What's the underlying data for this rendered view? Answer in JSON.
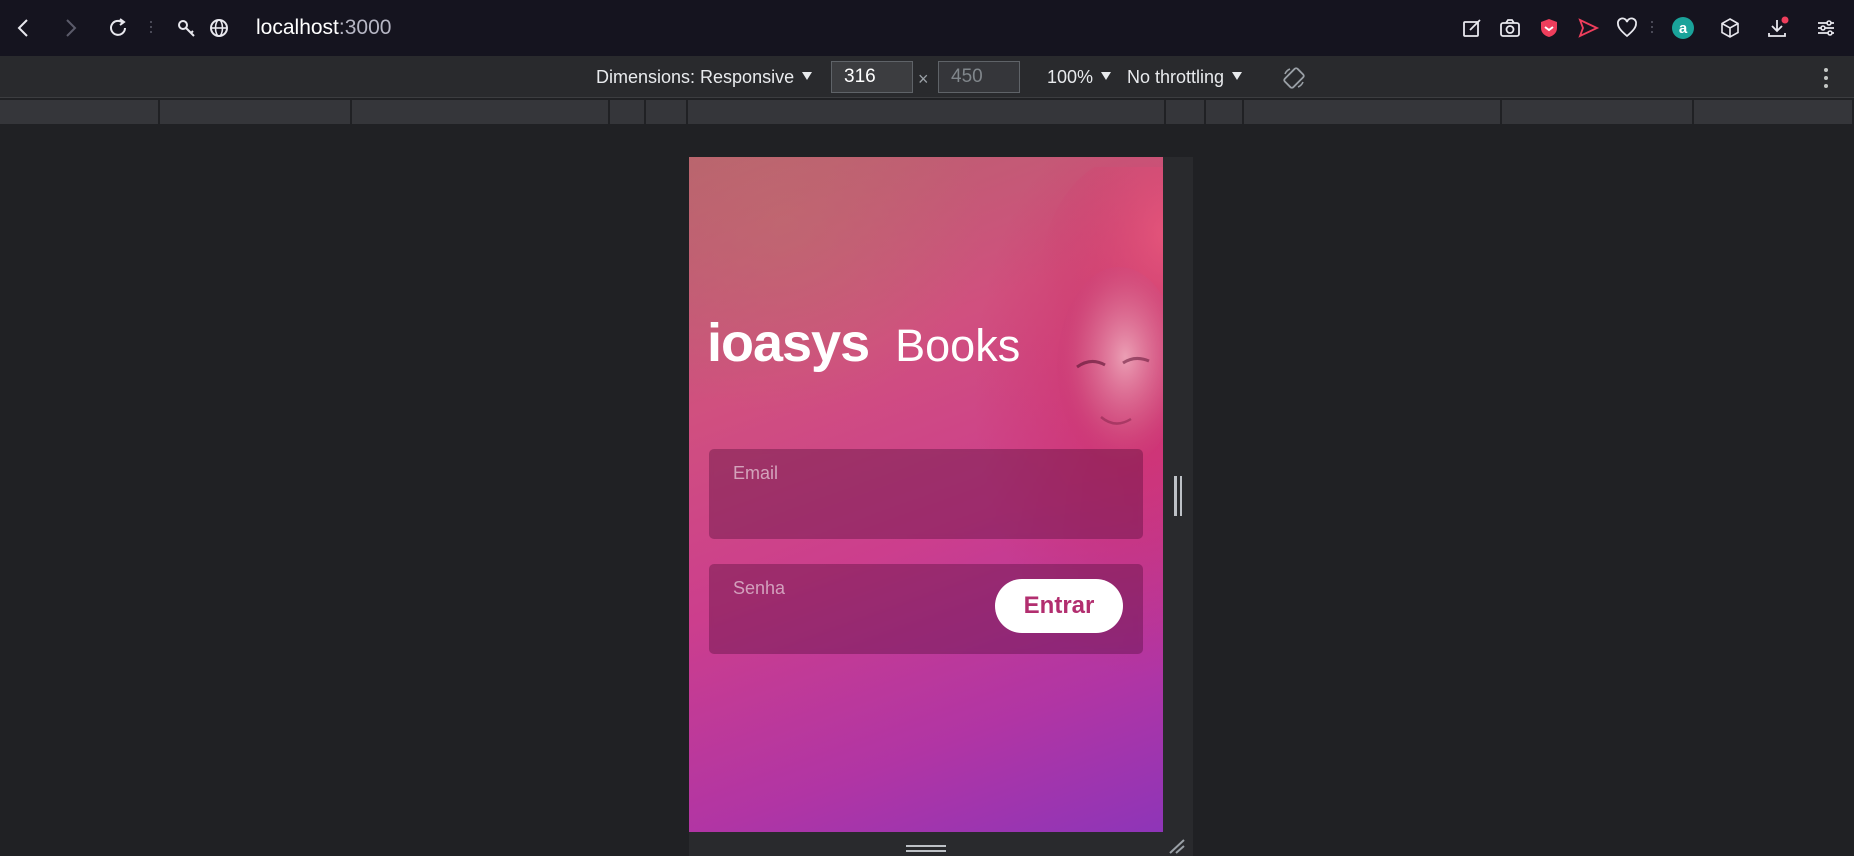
{
  "browser": {
    "url_host": "localhost",
    "url_port": ":3000",
    "icons": [
      "back-icon",
      "forward-icon",
      "reload-icon",
      "key-icon",
      "globe-icon",
      "edit-icon",
      "camera-icon",
      "shield-icon",
      "send-icon",
      "heart-icon",
      "account-icon",
      "cube-icon",
      "download-icon",
      "settings-icon"
    ],
    "account_letter": "a"
  },
  "devtools": {
    "dimensions_label": "Dimensions: Responsive",
    "width": "316",
    "times": "×",
    "height": "450",
    "zoom": "100%",
    "throttling": "No throttling"
  },
  "app": {
    "brand_logo": "ioasys",
    "brand_sub": "Books",
    "email_label": "Email",
    "password_label": "Senha",
    "submit_label": "Entrar",
    "colors": {
      "gradient_top": "#c2606e",
      "gradient_bottom": "#8e35b8",
      "button_text": "#b22e6f"
    }
  }
}
